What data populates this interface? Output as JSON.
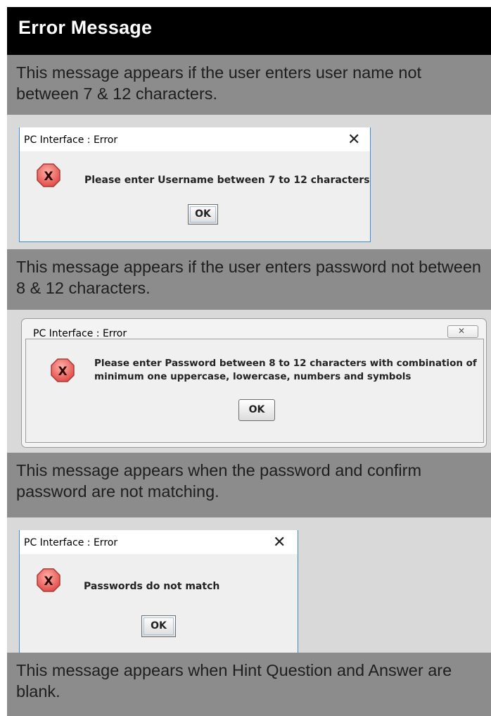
{
  "header": {
    "title": "Error Message"
  },
  "sections": [
    {
      "description": "This message appears if the user enters user name not between 7 & 12 characters.",
      "dialog": {
        "title": "PC Interface : Error",
        "message": "Please enter Username between 7 to 12 characters",
        "ok_label": "OK",
        "close_glyph": "✕"
      }
    },
    {
      "description": "This message appears if the user enters password not between 8 & 12 characters.",
      "dialog": {
        "title": "PC Interface : Error",
        "message": "Please enter Password between 8 to 12 characters with combination of minimum one uppercase, lowercase, numbers and symbols",
        "ok_label": "OK",
        "close_glyph": "✕"
      }
    },
    {
      "description": "This message appears when the password and confirm password are not matching.",
      "dialog": {
        "title": "PC Interface : Error",
        "message": "Passwords do not match",
        "ok_label": "OK",
        "close_glyph": "✕"
      }
    },
    {
      "description": "This message appears when Hint Question and Answer are blank."
    }
  ],
  "icons": {
    "error": "error-x-octagon-icon",
    "close": "close-icon"
  },
  "colors": {
    "header_bg": "#000000",
    "band_bg": "#8c8c8c",
    "page_bg": "#d9d9d9",
    "error_icon": "#e45a5a"
  }
}
